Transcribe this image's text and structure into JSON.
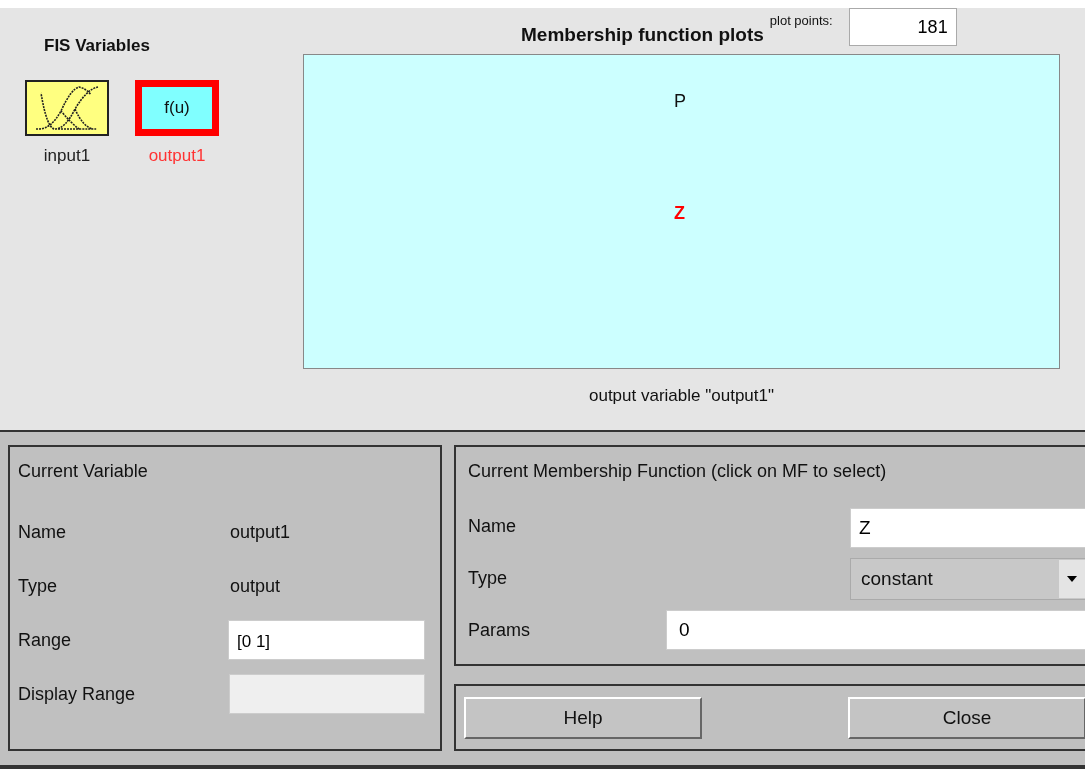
{
  "fis_variables": {
    "title": "FIS Variables",
    "items": [
      {
        "name": "input1",
        "kind": "input",
        "selected": false
      },
      {
        "name": "output1",
        "kind": "output",
        "label": "f(u)",
        "selected": true
      }
    ]
  },
  "plot": {
    "title": "Membership function plots",
    "plot_points_label": "plot points:",
    "plot_points": "181",
    "membership_functions": [
      {
        "name": "P",
        "selected": false
      },
      {
        "name": "Z",
        "selected": true
      }
    ],
    "caption": "output variable \"output1\""
  },
  "current_variable": {
    "title": "Current Variable",
    "name_label": "Name",
    "name": "output1",
    "type_label": "Type",
    "type": "output",
    "range_label": "Range",
    "range": "[0 1]",
    "display_range_label": "Display Range"
  },
  "current_mf": {
    "title": "Current Membership Function (click on MF to select)",
    "name_label": "Name",
    "name": "Z",
    "type_label": "Type",
    "type": "constant",
    "params_label": "Params",
    "params": "0"
  },
  "buttons": [
    "Help",
    "Close"
  ]
}
